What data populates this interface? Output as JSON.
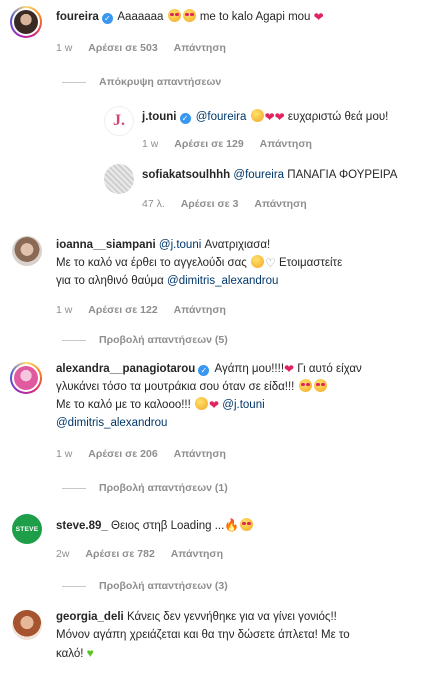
{
  "comments": [
    {
      "user": "foureira",
      "verified": true,
      "text": "Aaaaaaa 😍😍 me to kalo Agapi mou ❤️",
      "text_main": "Aaaaaaa",
      "text_tail": "me to kalo Agapi mou",
      "time": "1 w",
      "likes": "Αρέσει σε 503",
      "reply": "Απάντηση"
    },
    {
      "user": "j.touni",
      "verified": true,
      "mention": "@foureira",
      "text_tail": "ευχαριστώ θεά μου!",
      "time": "1 w",
      "likes": "Αρέσει σε 129",
      "reply": "Απάντηση"
    },
    {
      "user": "sofiakatsoulhhh",
      "mention": "@foureira",
      "text_tail": "ΠΑΝΑΓΙΑ ΦΟΥΡΕΙΡΑ",
      "time": "47 λ.",
      "likes": "Αρέσει σε 3",
      "reply": "Απάντηση"
    },
    {
      "user": "ioanna__siampani",
      "mention": "@j.touni",
      "line1": "Ανατριχιασα!",
      "line2a": "Με το καλό να έρθει το αγγελούδι σας",
      "line2b": "Ετοιμαστείτε",
      "line3a": "για το αληθινό θαύμα",
      "mention2": "@dimitris_alexandrou",
      "time": "1 w",
      "likes": "Αρέσει σε 122",
      "reply": "Απάντηση"
    },
    {
      "user": "alexandra__panagiotarou",
      "verified": true,
      "line1a": "Αγάπη μου!!!!",
      "line1b": "Γι αυτό είχαν",
      "line2": "γλυκάνει τόσο τα μουτράκια σου όταν σε είδα!!!",
      "line3": "Με το καλό με το καλοοο!!!",
      "mention": "@j.touni",
      "mention2": "@dimitris_alexandrou",
      "time": "1 w",
      "likes": "Αρέσει σε 206",
      "reply": "Απάντηση"
    },
    {
      "user": "steve.89_",
      "text": "Θειος στηβ Loading ...",
      "avatar_text": "STEVE",
      "time": "2w",
      "likes": "Αρέσει σε 782",
      "reply": "Απάντηση"
    },
    {
      "user": "georgia_deli",
      "line1": "Κάνεις δεν γεννήθηκε για να γίνει γονιός!!",
      "line2": "Μόνον αγάπη χρειάζεται και θα την δώσετε άπλετα! Με το",
      "line3": "καλό!"
    }
  ],
  "toggles": {
    "hide_replies": "Απόκρυψη απαντήσεων",
    "view_replies_5": "Προβολή απαντήσεων (5)",
    "view_replies_1": "Προβολή απαντήσεων (1)",
    "view_replies_3": "Προβολή απαντήσεων (3)"
  },
  "avatars": {
    "jtouni_letter": "J."
  },
  "colors": {
    "mention": "#00376b",
    "verified": "#3897f0",
    "meta": "#8e8e8e",
    "steve_green": "#1f9e4a"
  }
}
